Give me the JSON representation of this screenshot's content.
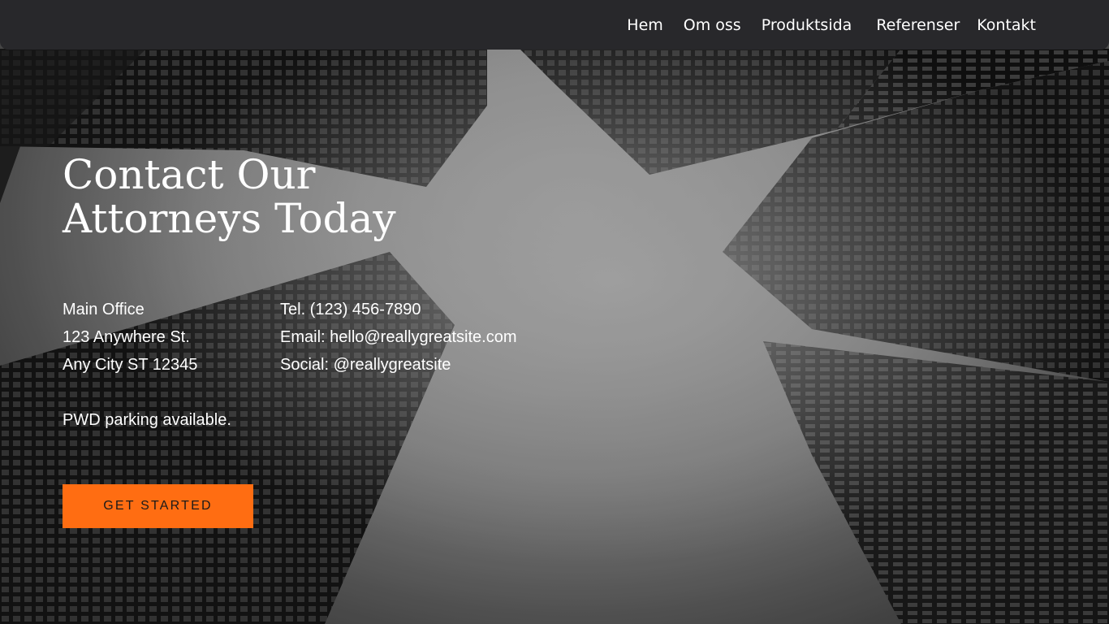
{
  "nav": {
    "items": [
      {
        "label": "Hem"
      },
      {
        "label": "Om oss"
      },
      {
        "label": "Produktsida"
      },
      {
        "label": "Referenser"
      },
      {
        "label": "Kontakt"
      }
    ]
  },
  "hero": {
    "title_line1": "Contact Our",
    "title_line2": "Attorneys Today"
  },
  "office": {
    "name": "Main Office",
    "street": "123 Anywhere St.",
    "city": "Any City ST 12345"
  },
  "contact": {
    "tel": "Tel. (123) 456-7890",
    "email": "Email: hello@reallygreatsite.com",
    "social": "Social: @reallygreatsite"
  },
  "parking": "PWD parking available.",
  "cta": {
    "label": "GET STARTED"
  },
  "colors": {
    "accent": "#ff6d12",
    "nav_bg": "#28282b"
  }
}
